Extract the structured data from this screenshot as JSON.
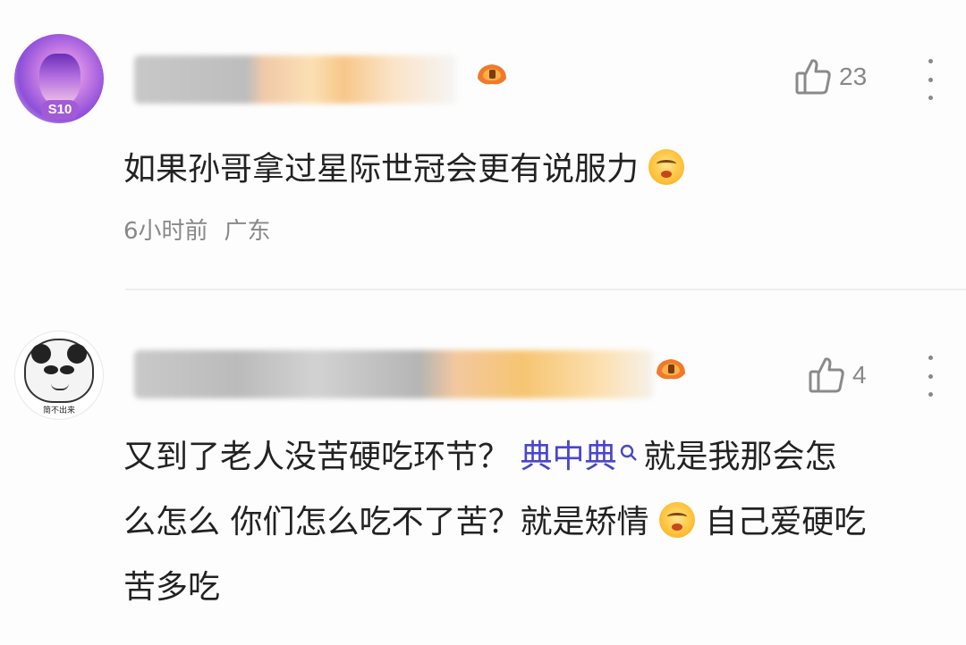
{
  "comments": [
    {
      "badge": "S10",
      "likes": "23",
      "text": "如果孙哥拿过星际世冠会更有说服力",
      "time": "6小时前",
      "location": "广东",
      "emoji": "grimace-emoji"
    },
    {
      "avatar_caption": "简不出来",
      "likes": "4",
      "line1_a": "又到了老人没苦硬吃环节？",
      "tag": "典中典",
      "line1_b": "就是我那会怎",
      "line2_a": "么怎么 你们怎么吃不了苦？就是矫情",
      "line2_b": "自己爱硬吃",
      "line3": "苦多吃"
    }
  ],
  "colors": {
    "text": "#222222",
    "meta": "#888888",
    "tag": "#4a46c7",
    "emoji": "#ffc43d"
  }
}
